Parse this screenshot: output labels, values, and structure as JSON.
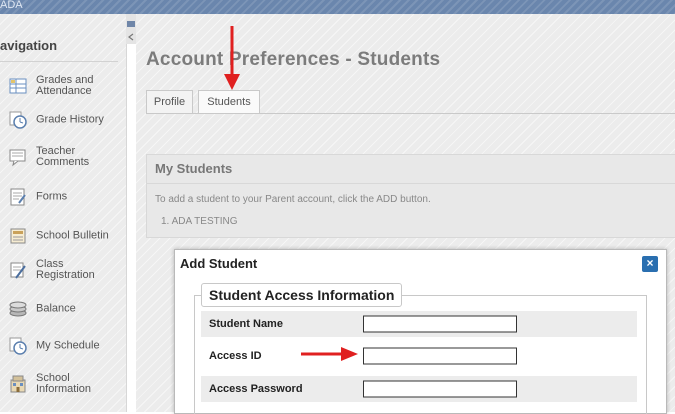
{
  "topbar": {
    "text": "ADA"
  },
  "sidebar": {
    "title": "avigation",
    "items": [
      {
        "label": "Grades and Attendance",
        "icon": "grades-icon"
      },
      {
        "label": "Grade History",
        "icon": "clock-icon"
      },
      {
        "label": "Teacher Comments",
        "icon": "comments-icon"
      },
      {
        "label": "Forms",
        "icon": "forms-icon"
      },
      {
        "label": "School Bulletin",
        "icon": "bulletin-icon"
      },
      {
        "label": "Class Registration",
        "icon": "registration-icon"
      },
      {
        "label": "Balance",
        "icon": "coins-icon"
      },
      {
        "label": "My Schedule",
        "icon": "clock-icon"
      },
      {
        "label": "School Information",
        "icon": "building-icon"
      }
    ]
  },
  "main": {
    "title": "Account Preferences - Students",
    "tabs": [
      {
        "label": "Profile"
      },
      {
        "label": "Students"
      }
    ],
    "my_students": {
      "title": "My Students",
      "hint": "To add a student to your Parent account, click the ADD button.",
      "items": [
        "1. ADA TESTING"
      ]
    }
  },
  "dialog": {
    "title": "Add Student",
    "close": "×",
    "section": "Student Access Information",
    "fields": [
      {
        "label": "Student Name",
        "value": ""
      },
      {
        "label": "Access ID",
        "value": ""
      },
      {
        "label": "Access Password",
        "value": ""
      }
    ]
  },
  "colors": {
    "topbar": "#6a86ad",
    "arrow": "#e02020",
    "close_button": "#2a6fb0"
  }
}
